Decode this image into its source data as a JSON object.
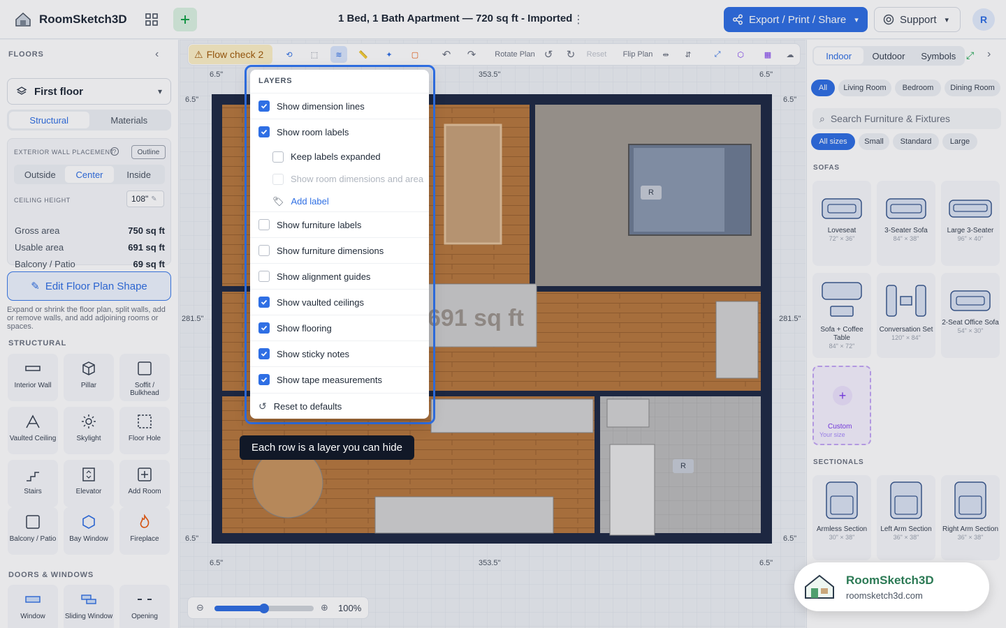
{
  "app": {
    "name": "RoomSketch3D",
    "doc_title": "1 Bed, 1 Bath Apartment — 720 sq ft - Imported",
    "export_label": "Export / Print / Share",
    "support_label": "Support",
    "avatar": "R"
  },
  "left": {
    "section": "FLOORS",
    "floor": "First floor",
    "tabs": [
      "Structural",
      "Materials"
    ],
    "wall_placement_label": "EXTERIOR WALL PLACEMENT",
    "outline_badge": "Outline",
    "placement": [
      "Outside",
      "Center",
      "Inside"
    ],
    "ceiling_label": "CEILING HEIGHT",
    "ceiling_value": "108\"",
    "stats": [
      {
        "label": "Gross area",
        "value": "750 sq ft"
      },
      {
        "label": "Usable area",
        "value": "691 sq ft"
      },
      {
        "label": "Balcony / Patio",
        "value": "69 sq ft"
      }
    ],
    "edit_btn": "Edit Floor Plan Shape",
    "hint": "Expand or shrink the floor plan, split walls, add or remove walls, and add adjoining rooms or spaces.",
    "structural_label": "STRUCTURAL",
    "tools": [
      "Interior Wall",
      "Pillar",
      "Soffit / Bulkhead",
      "Vaulted Ceiling",
      "Skylight",
      "Floor Hole",
      "Stairs",
      "Elevator",
      "Add Room",
      "Balcony / Patio",
      "Bay Window",
      "Fireplace"
    ],
    "doors_label": "DOORS & WINDOWS",
    "doors": [
      "Window",
      "Sliding Window",
      "Opening"
    ]
  },
  "toolbar": {
    "flow_check": "Flow check 2",
    "rotate": "Rotate Plan",
    "reset": "Reset",
    "flip": "Flip Plan"
  },
  "canvas": {
    "dim_top_left": "6.5\"",
    "dim_top_mid": "353.5\"",
    "dim_top_right": "6.5\"",
    "dim_side": "281.5\"",
    "dim_bottom_left": "6.5\"",
    "dim_bottom_mid": "353.5\"",
    "dim_bottom_right": "6.5\"",
    "room_area": "691 sq ft",
    "tag": "R"
  },
  "layers": {
    "title": "LAYERS",
    "items": [
      {
        "label": "Show dimension lines",
        "checked": true
      },
      {
        "label": "Show room labels",
        "checked": true
      },
      {
        "label": "Keep labels expanded",
        "checked": false
      },
      {
        "label": "Show room dimensions and area",
        "checked": false
      },
      {
        "label": "Add label",
        "checked": false
      },
      {
        "label": "Show furniture labels",
        "checked": false
      },
      {
        "label": "Show furniture dimensions",
        "checked": false
      },
      {
        "label": "Show alignment guides",
        "checked": false
      },
      {
        "label": "Show vaulted ceilings",
        "checked": true
      },
      {
        "label": "Show flooring",
        "checked": true
      },
      {
        "label": "Show sticky notes",
        "checked": true
      },
      {
        "label": "Show tape measurements",
        "checked": true
      }
    ],
    "reset": "Reset to defaults"
  },
  "tooltip": "Each row is a layer you can hide",
  "zoom": {
    "value": "100%",
    "level": 0.5
  },
  "right": {
    "tabs": [
      "Indoor",
      "Outdoor",
      "Symbols"
    ],
    "rooms": [
      "All",
      "Living Room",
      "Bedroom",
      "Dining Room"
    ],
    "search_placeholder": "Search Furniture & Fixtures",
    "sizes": [
      "All sizes",
      "Small",
      "Standard",
      "Large"
    ],
    "sofas_label": "SOFAS",
    "sofas": [
      {
        "name": "Loveseat",
        "size": "72\" × 36\""
      },
      {
        "name": "3-Seater Sofa",
        "size": "84\" × 38\""
      },
      {
        "name": "Large 3-Seater",
        "size": "96\" × 40\""
      },
      {
        "name": "Sofa + Coffee Table",
        "size": "84\" × 72\""
      },
      {
        "name": "Conversation Set",
        "size": "120\" × 84\""
      },
      {
        "name": "2-Seat Office Sofa",
        "size": "54\" × 30\""
      }
    ],
    "custom": {
      "name": "Custom",
      "sub": "Your size"
    },
    "sectionals_label": "SECTIONALS",
    "sectionals": [
      {
        "name": "Armless Section",
        "size": "30\" × 38\""
      },
      {
        "name": "Left Arm Section",
        "size": "36\" × 38\""
      },
      {
        "name": "Right Arm Section",
        "size": "36\" × 38\""
      }
    ]
  },
  "promo": {
    "name": "RoomSketch3D",
    "url": "roomsketch3d.com"
  }
}
